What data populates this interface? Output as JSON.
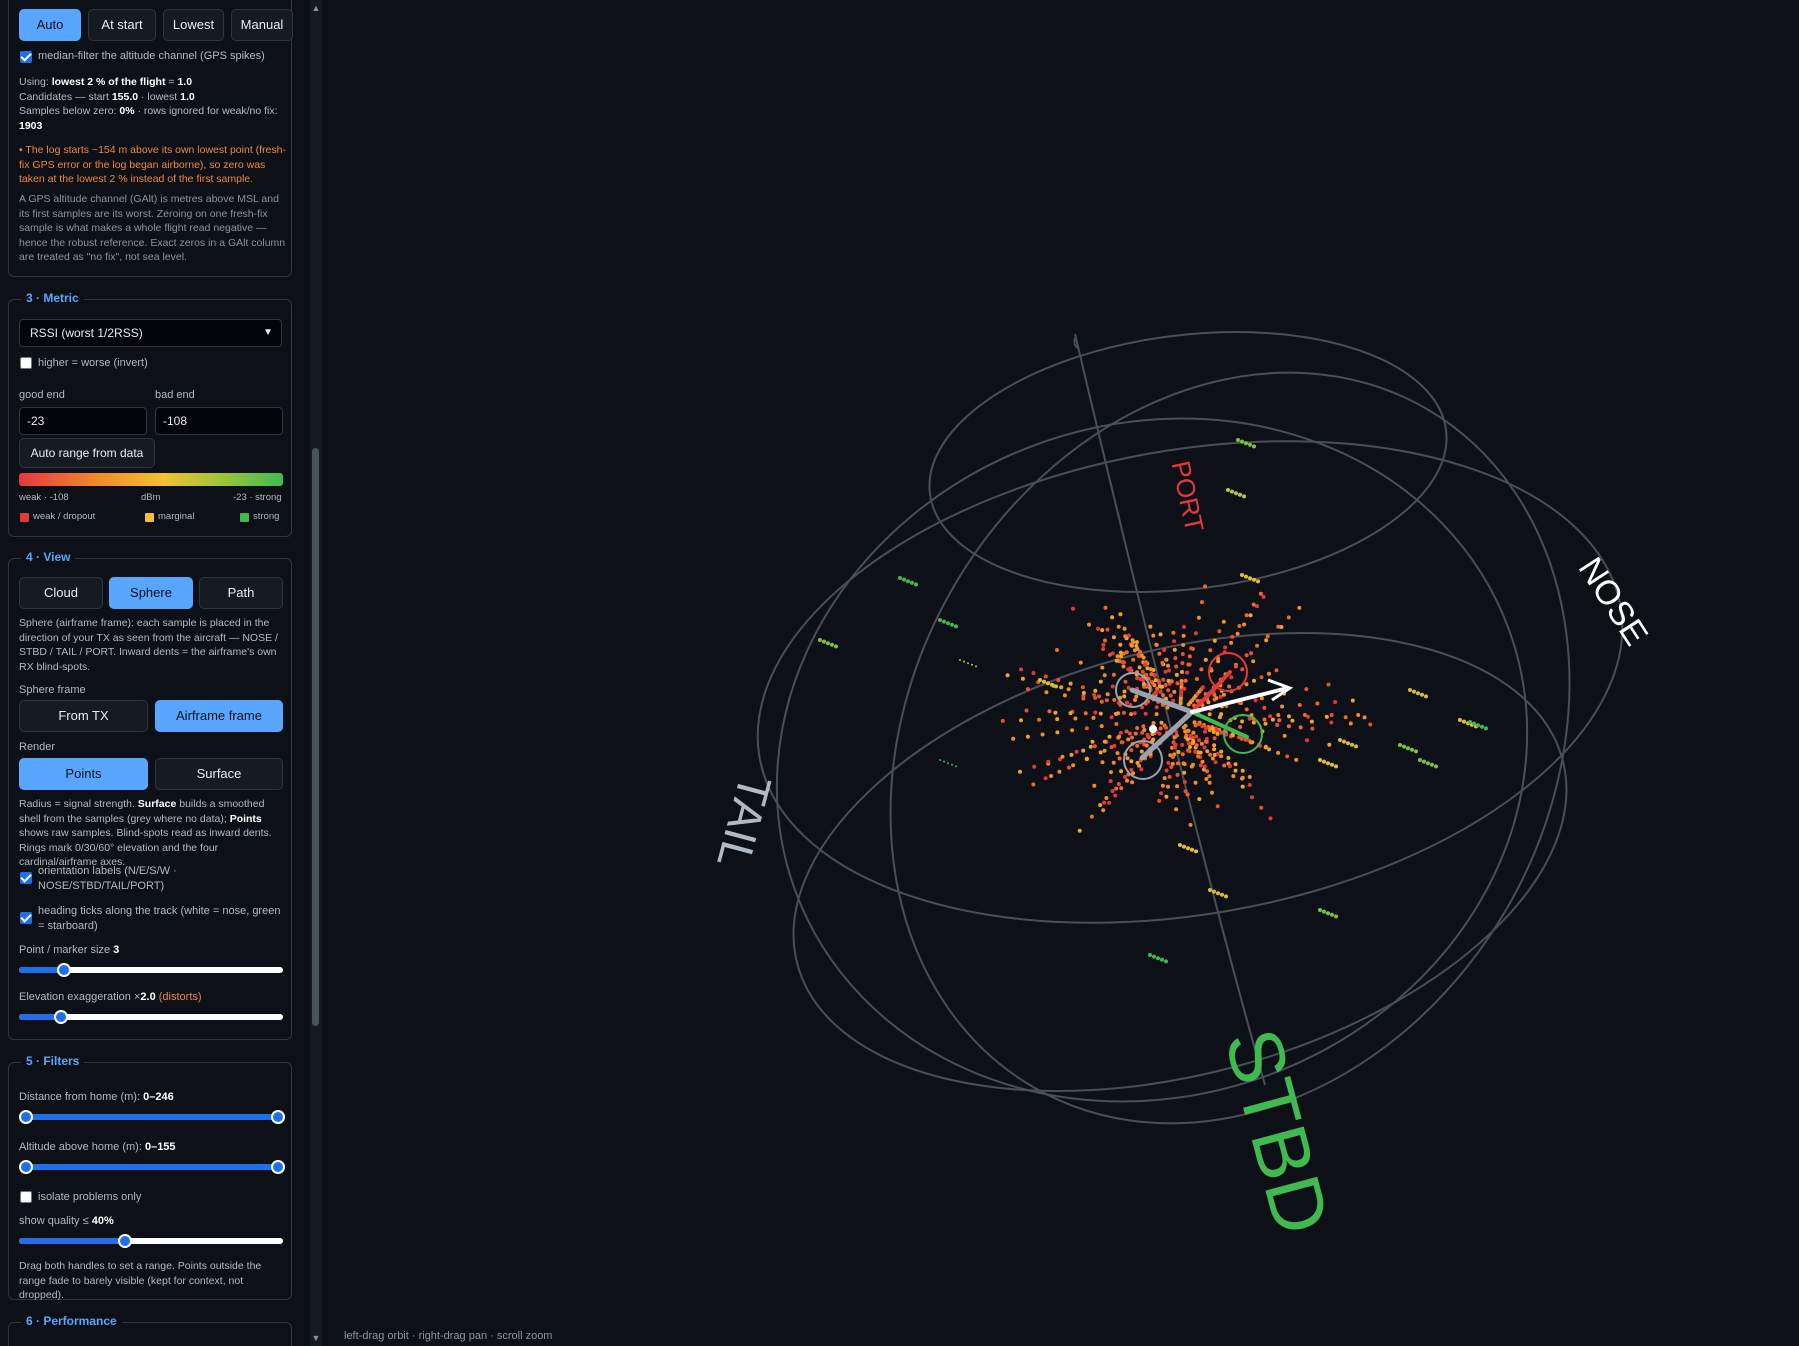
{
  "alt_zero": {
    "buttons": [
      "Auto",
      "At start",
      "Lowest",
      "Manual"
    ],
    "active": "Auto",
    "median_filter_label": "median-filter the altitude channel (GPS spikes)",
    "using_prefix": "Using:",
    "using_value": "lowest 2 % of the flight",
    "using_eq": "=",
    "using_num": "1.0",
    "candidates_prefix": "Candidates — start",
    "candidates_start": "155.0",
    "candidates_mid": "· lowest",
    "candidates_lowest": "1.0",
    "below_zero_prefix": "Samples below zero:",
    "below_zero_value": "0%",
    "rows_ignored_prefix": "· rows ignored for weak/no fix:",
    "rows_ignored_value": "1903",
    "warning": "• The log starts ~154 m above its own lowest point (fresh-fix GPS error or the log began airborne), so zero was taken at the lowest 2 % instead of the first sample.",
    "explain": "A GPS altitude channel (GAlt) is metres above MSL and its first samples are its worst. Zeroing on one fresh-fix sample is what makes a whole flight read negative — hence the robust reference. Exact zeros in a GAlt column are treated as \"no fix\", not sea level."
  },
  "metric": {
    "title": "3 · Metric",
    "selected": "RSSI (worst 1/2RSS)",
    "invert_label": "higher = worse (invert)",
    "good_end_label": "good end",
    "bad_end_label": "bad end",
    "good_end": "-23",
    "bad_end": "-108",
    "auto_range": "Auto range from data",
    "scale_left": "weak · -108",
    "scale_mid": "dBm",
    "scale_right": "-23 · strong",
    "legend": [
      "weak / dropout",
      "marginal",
      "strong"
    ],
    "legend_colors": [
      "#e5383b",
      "#f2c230",
      "#3fb950"
    ]
  },
  "view": {
    "title": "4 · View",
    "modes": [
      "Cloud",
      "Sphere",
      "Path"
    ],
    "mode_active": "Sphere",
    "sphere_desc": "Sphere (airframe frame): each sample is placed in the direction of your TX as seen from the aircraft — NOSE / STBD / TAIL / PORT. Inward dents = the airframe's own RX blind-spots.",
    "frame_label": "Sphere frame",
    "frames": [
      "From TX",
      "Airframe frame"
    ],
    "frame_active": "Airframe frame",
    "render_label": "Render",
    "renders": [
      "Points",
      "Surface"
    ],
    "render_active": "Points",
    "render_desc_a": "Radius = signal strength.",
    "render_desc_b": "Surface",
    "render_desc_c": "builds a smoothed shell from the samples (grey where no data);",
    "render_desc_d": "Points",
    "render_desc_e": "shows raw samples. Blind-spots read as inward dents. Rings mark 0/30/60° elevation and the four cardinal/airframe axes.",
    "orient_label": "orientation labels (N/E/S/W · NOSE/STBD/TAIL/PORT)",
    "heading_label": "heading ticks along the track (white = nose, green = starboard)",
    "marker_label": "Point / marker size",
    "marker_value": "3",
    "marker_fraction": 0.17,
    "elev_label": "Elevation exaggeration ×",
    "elev_value": "2.0",
    "elev_note": "(distorts)",
    "elev_fraction": 0.16
  },
  "filters": {
    "title": "5 · Filters",
    "dist_label": "Distance from home (m):",
    "dist_value": "0–246",
    "alt_label": "Altitude above home (m):",
    "alt_value": "0–155",
    "isolate_label": "isolate problems only",
    "quality_label": "show quality ≤",
    "quality_value": "40%",
    "quality_fraction": 0.4,
    "hint": "Drag both handles to set a range. Points outside the range fade to barely visible (kept for context, not dropped)."
  },
  "performance": {
    "title": "6 · Performance"
  },
  "scene": {
    "labels": {
      "port": "PORT",
      "nose": "NOSE",
      "tail": "TAIL",
      "stbd": "STBD"
    },
    "colors": {
      "port": "#e5383b",
      "nose": "#ffffff",
      "tail": "#b1bac4",
      "stbd": "#3fb950",
      "ring": "#4a4f57"
    }
  },
  "status_hint": "left-drag orbit · right-drag pan · scroll zoom"
}
